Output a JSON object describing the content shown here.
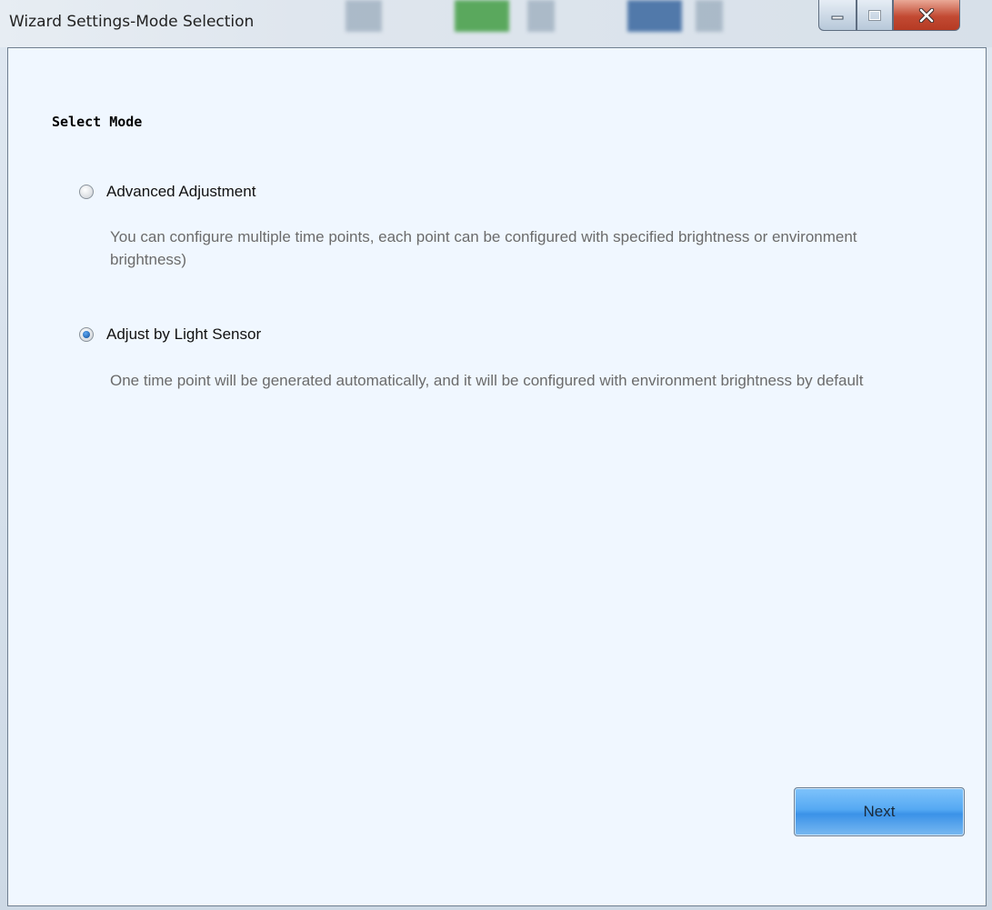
{
  "window": {
    "title": "Wizard Settings-Mode Selection"
  },
  "page": {
    "heading": "Select Mode"
  },
  "options": [
    {
      "label": "Advanced Adjustment",
      "checked": false,
      "description": "You can configure multiple time points, each point can be configured with specified brightness or environment brightness)"
    },
    {
      "label": "Adjust by Light Sensor",
      "checked": true,
      "description": "One time point will be generated automatically, and it will be configured with environment brightness by default"
    }
  ],
  "buttons": {
    "next": "Next"
  },
  "icons": {
    "minimize": "minimize-icon",
    "maximize": "maximize-icon",
    "close": "close-icon"
  },
  "colors": {
    "content_bg": "#f0f7ff",
    "accent": "#3b92e8",
    "close_red": "#c24a33"
  }
}
